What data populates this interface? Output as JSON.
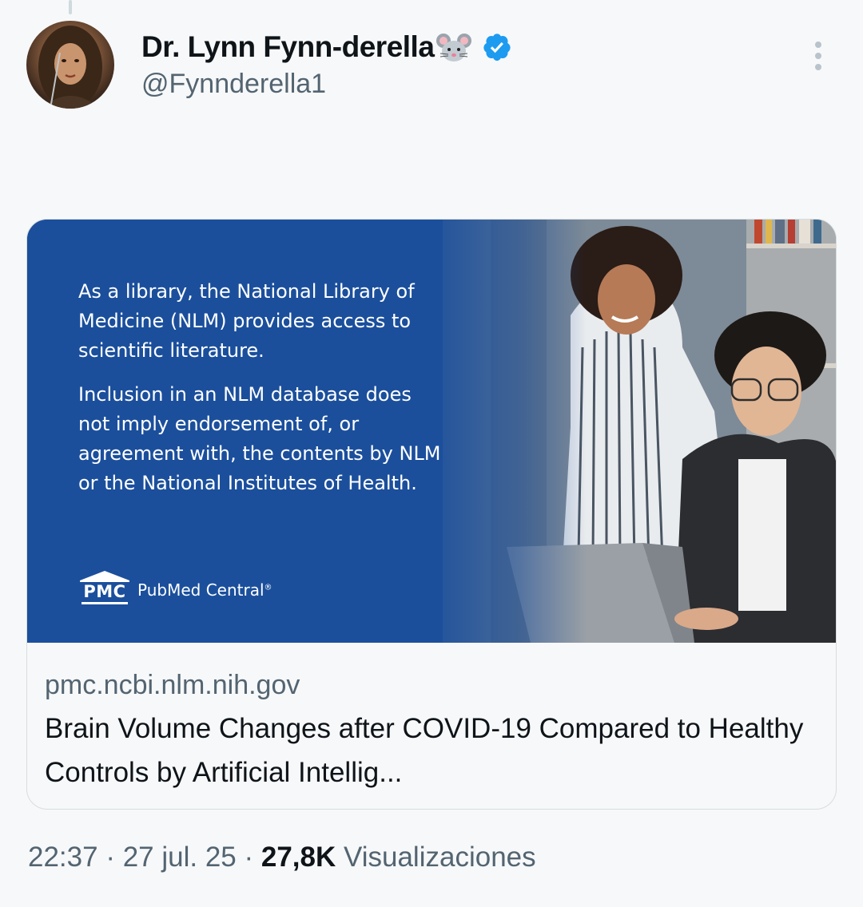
{
  "author": {
    "display_name": "Dr. Lynn Fynn-derella",
    "name_emoji": "mouse-face",
    "verified": true,
    "handle": "@Fynnderella1",
    "verified_color": "#1d9bf0"
  },
  "more_icon": "more-vertical-icon",
  "link_card": {
    "image": {
      "disclaimer_paragraphs": [
        "As a library, the National Library of Medicine (NLM) provides access to scientific literature.",
        "Inclusion in an NLM database does not imply endorsement of, or agreement with, the contents by NLM or the National Institutes of Health."
      ],
      "logo_mark": "PMC",
      "logo_text": "PubMed Central",
      "logo_reg": "®",
      "background_color": "#1b4f9c"
    },
    "domain": "pmc.ncbi.nlm.nih.gov",
    "title": "Brain Volume Changes after COVID-19 Compared to Healthy Controls by Artificial Intellig..."
  },
  "tweet_meta": {
    "time": "22:37",
    "separator": " · ",
    "date": "27 jul. 25",
    "views_count": "27,8K",
    "views_label": "Visualizaciones"
  }
}
